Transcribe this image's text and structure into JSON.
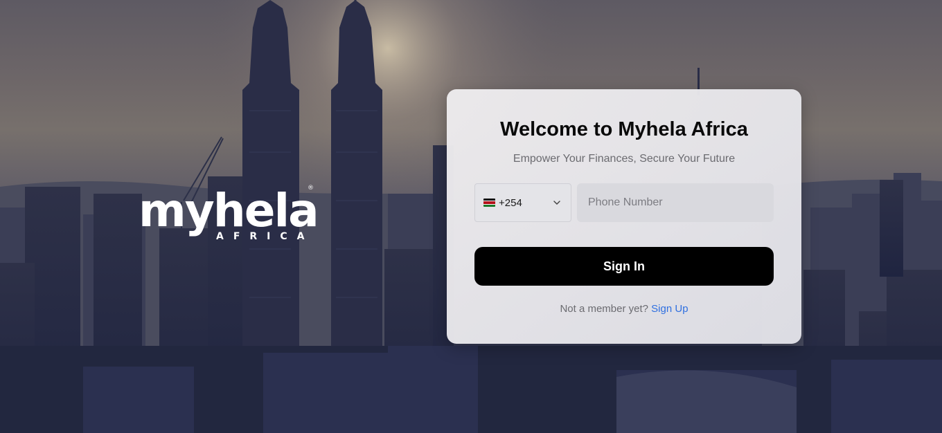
{
  "brand": {
    "logo_word": "myhela",
    "logo_sub": "AFRICA",
    "logo_mark": "®"
  },
  "login": {
    "title": "Welcome to Myhela Africa",
    "subtitle": "Empower Your Finances, Secure Your Future",
    "country": {
      "flag": "kenya-flag-icon",
      "dial_code": "+254"
    },
    "phone_placeholder": "Phone Number",
    "phone_value": "",
    "sign_in_label": "Sign In",
    "signup_prompt": "Not a member yet?",
    "signup_link": "Sign Up"
  },
  "colors": {
    "button": "#000000",
    "link": "#2f6fe0",
    "card": "#e6e6ea"
  }
}
